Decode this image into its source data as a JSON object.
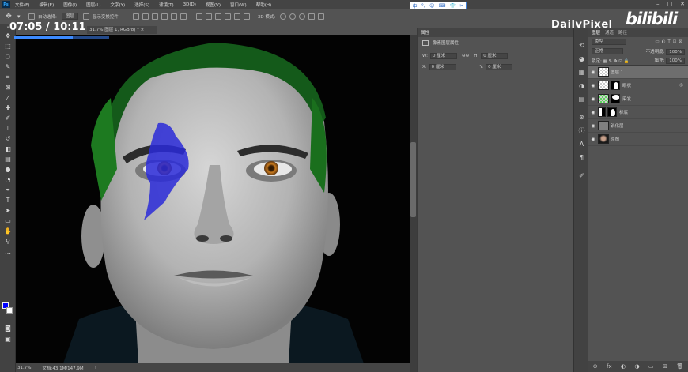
{
  "menu": {
    "logo": "Ps",
    "items": [
      "文件(F)",
      "编辑(E)",
      "图像(I)",
      "图层(L)",
      "文字(Y)",
      "选择(S)",
      "滤镜(T)",
      "3D(D)",
      "视图(V)",
      "窗口(W)",
      "帮助(H)"
    ],
    "controls": [
      "–",
      "□",
      "✕"
    ]
  },
  "ime": {
    "items": [
      "中",
      "°,",
      "☺",
      "⌨",
      "👕",
      "✂"
    ]
  },
  "options": {
    "auto_select": "自动选择:",
    "auto_select_value": "图层",
    "show_transform": "显示变换控件",
    "mode_3d": "3D 模式:"
  },
  "watermark": {
    "logo_text": "DailyPixel",
    "brand": "bilibili"
  },
  "video": {
    "timer": "07:05 / 10:11",
    "progress": 0.62
  },
  "document": {
    "tab_label": "图层 1, RGB/8) *",
    "tab_zoom": "31.7%",
    "close": "×",
    "status_zoom": "31.7%",
    "status_doc": "文档:43.1M/147.9M",
    "status_arrow": "›"
  },
  "colors": {
    "foreground": "#0000ff",
    "background": "#ffffff"
  },
  "properties": {
    "panel_title": "属性",
    "section_title": "像素图层属性",
    "w_label": "W:",
    "w_value": "0 厘米",
    "h_label": "H:",
    "h_value": "0 厘米",
    "x_label": "X:",
    "x_value": "0 厘米",
    "y_label": "Y:",
    "y_value": "0 厘米",
    "link_icon": "⊖⊖"
  },
  "layers_panel": {
    "tabs": [
      "图层",
      "通道",
      "路径"
    ],
    "kind_label": "类型",
    "blend_mode": "正常",
    "opacity_label": "不透明度:",
    "opacity_value": "100%",
    "lock_label": "锁定:",
    "lock_icons": "▦ ✎ ✥ ⊡ 🔒",
    "fill_label": "填充:",
    "fill_value": "100%",
    "layers": [
      {
        "name": "图层 1",
        "selected": true,
        "thumb": "checker",
        "mask": ""
      },
      {
        "name": "眼状",
        "selected": false,
        "thumb": "checker",
        "mask": "face"
      },
      {
        "name": "染发",
        "selected": false,
        "thumb": "green",
        "mask": "face"
      },
      {
        "name": "标底",
        "selected": false,
        "thumb": "adjust",
        "mask": "face"
      },
      {
        "name": "锐化层",
        "selected": false,
        "thumb": "gray",
        "mask": ""
      },
      {
        "name": "原图",
        "selected": false,
        "thumb": "photo",
        "mask": ""
      }
    ],
    "bottom_icons": [
      "⊖",
      "fx",
      "◐",
      "◑",
      "▭",
      "⊞",
      "🗑"
    ]
  }
}
